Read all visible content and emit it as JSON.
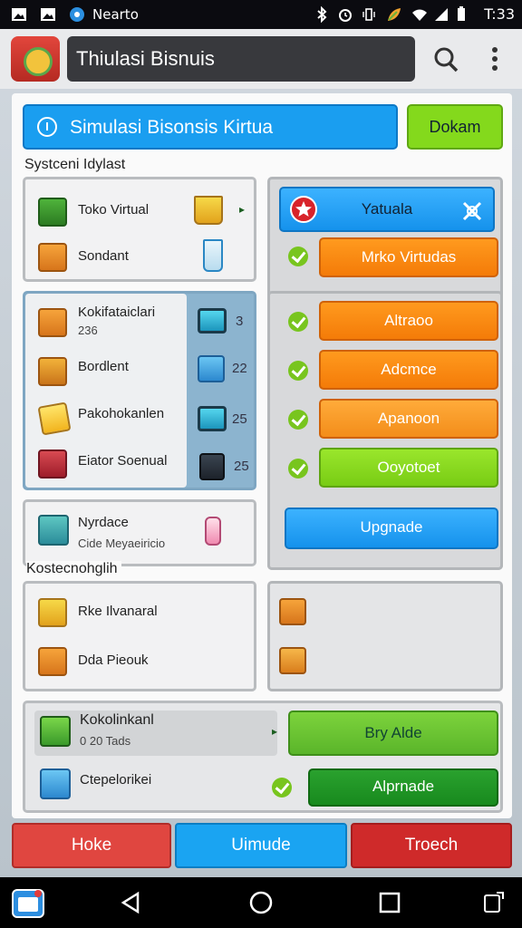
{
  "status_bar": {
    "app_name": "Nearto",
    "time": "T:33",
    "icons": [
      "image-icon",
      "image-icon",
      "app-icon",
      "bluetooth-icon",
      "alarm-icon",
      "vibrate-icon",
      "leaf-icon",
      "wifi-icon",
      "signal-icon",
      "battery-icon"
    ]
  },
  "app_bar": {
    "title": "Thiulasi Bisnuis",
    "icons": [
      "app-logo",
      "search-icon",
      "more-vert-icon"
    ]
  },
  "dialog": {
    "title": "Simulasi Bisonsis Kirtua",
    "header_button": "Dokam",
    "section1_label": "Systceni Idylast",
    "section2_label": "Kostecnohglih"
  },
  "panel_a": {
    "items": [
      {
        "label": "Toko Virtual",
        "icon": "gift-box-icon"
      },
      {
        "label": "Sondant",
        "icon": "crate-icon"
      }
    ],
    "side_icons": [
      "shopping-bag-icon",
      "cup-icon"
    ]
  },
  "panel_b": {
    "items": [
      {
        "label": "Kokifataiclari",
        "sub": "236",
        "icon": "box-icon"
      },
      {
        "label": "Bordlent",
        "icon": "basket-icon"
      },
      {
        "label": "Pakohokanlen",
        "icon": "note-icon"
      },
      {
        "label": "Eiator Soenual",
        "icon": "red-box-icon"
      }
    ],
    "side_values": [
      "3",
      "22",
      "25",
      "25"
    ]
  },
  "panel_c": {
    "title": "Nyrdace",
    "subtitle": "Cide Meyaeiricio",
    "icon": "building-icon"
  },
  "right_panel": {
    "header_button": "Yatuala",
    "buttons": [
      "Mrko Virtudas",
      "Altraoo",
      "Adcmce",
      "Apanoon",
      "Ooyotoet"
    ],
    "upgrade_button": "Upgnade"
  },
  "panel_d": {
    "items": [
      {
        "label": "Rke Ilvanaral",
        "icon": "yellow-box-icon"
      },
      {
        "label": "Dda Pieouk",
        "icon": "present-icon"
      }
    ]
  },
  "panel_f": {
    "items": [
      {
        "label": "Kokolinkanl",
        "sub": "0 20 Tads",
        "icon": "green-box-icon"
      },
      {
        "label": "Ctepelorikei",
        "icon": "blue-box-icon"
      }
    ],
    "buttons": [
      "Bry Alde",
      "Alprnade"
    ]
  },
  "bottom_tabs": [
    "Hoke",
    "Uimude",
    "Troech"
  ],
  "nav_bar": [
    "app-switch-icon",
    "back-icon",
    "home-icon",
    "recents-icon",
    "rotate-icon"
  ]
}
